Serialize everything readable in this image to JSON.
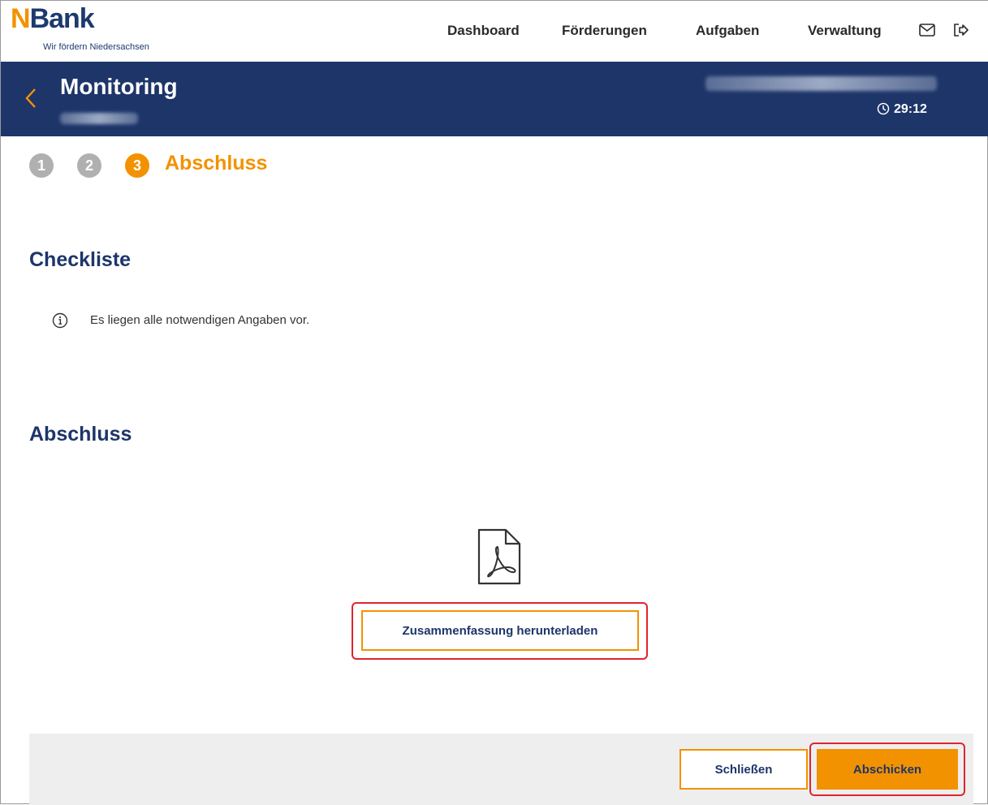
{
  "brand": {
    "logo_n": "N",
    "logo_rest": "Bank",
    "tagline": "Wir fördern Niedersachsen"
  },
  "nav": {
    "items": [
      {
        "label": "Dashboard"
      },
      {
        "label": "Förderungen"
      },
      {
        "label": "Aufgaben"
      },
      {
        "label": "Verwaltung"
      }
    ],
    "icons": [
      "mail-icon",
      "logout-icon"
    ]
  },
  "header": {
    "title": "Monitoring",
    "timer": "29:12"
  },
  "stepper": {
    "steps": [
      "1",
      "2",
      "3"
    ],
    "active_step": 3,
    "active_label": "Abschluss"
  },
  "checklist": {
    "title": "Checkliste",
    "message": "Es liegen alle notwendigen Angaben vor."
  },
  "summary": {
    "title": "Abschluss",
    "download_label": "Zusammenfassung herunterladen"
  },
  "footer": {
    "close_label": "Schließen",
    "submit_label": "Abschicken"
  },
  "colors": {
    "brand_blue": "#1d3569",
    "accent_orange": "#f39200",
    "step_inactive": "#b0b0b0",
    "highlight_red": "#e0242f",
    "footer_bg": "#eeeeee"
  }
}
